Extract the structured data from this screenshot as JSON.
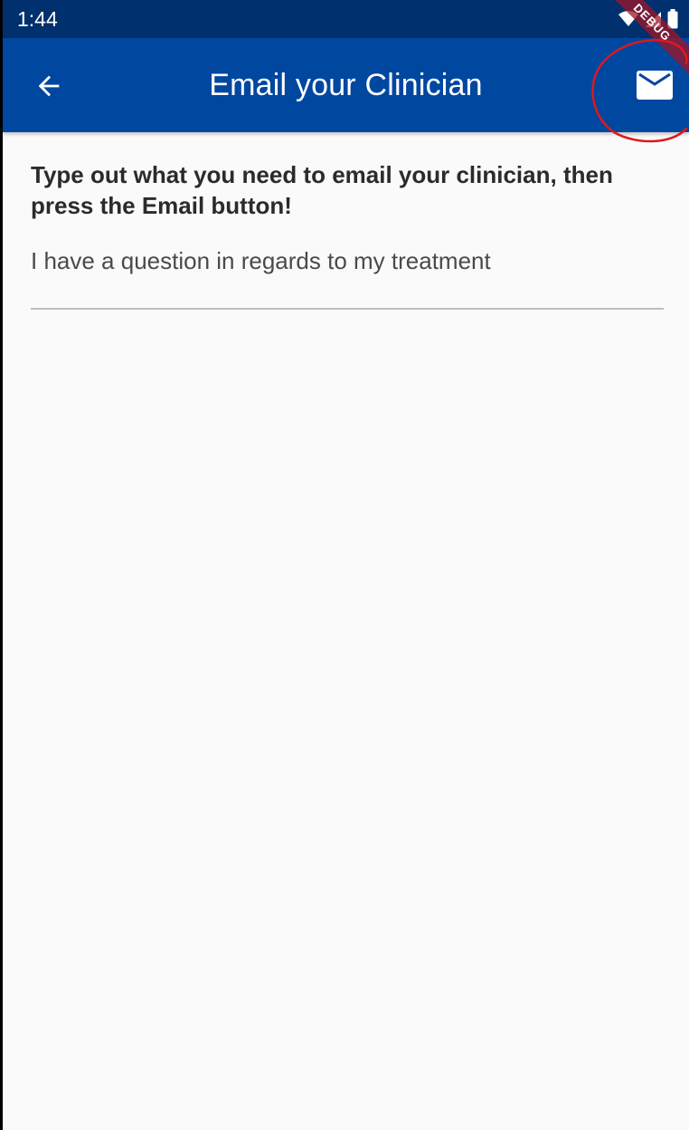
{
  "status_bar": {
    "time": "1:44"
  },
  "app_bar": {
    "title": "Email your Clinician",
    "back_icon": "arrow-left-icon",
    "email_icon": "envelope-icon",
    "debug_banner": "DEBUG"
  },
  "form": {
    "instruction": "Type out what you need to email your clinician, then press the Email button!",
    "message_value": "I have a question in regards to my treatment"
  },
  "colors": {
    "status_bar": "#00306e",
    "app_bar": "#0047a0",
    "background": "#fafafa",
    "annotation": "#e01818"
  }
}
